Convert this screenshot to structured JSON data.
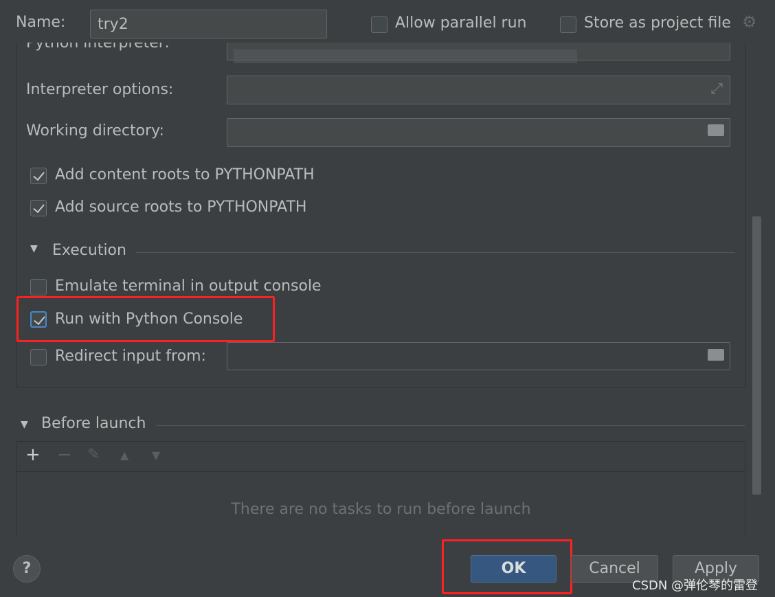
{
  "header": {
    "name_label": "Name:",
    "name_value": "try2",
    "allow_parallel_label": "Allow parallel run",
    "allow_parallel_checked": false,
    "store_label": "Store as project file",
    "store_checked": false
  },
  "config": {
    "interpreter_label": "Python interpreter:",
    "interpreter_options_label": "Interpreter options:",
    "working_dir_label": "Working directory:",
    "add_content_roots": {
      "label": "Add content roots to PYTHONPATH",
      "checked": true
    },
    "add_source_roots": {
      "label": "Add source roots to PYTHONPATH",
      "checked": true
    }
  },
  "execution": {
    "title": "Execution",
    "emulate_terminal": {
      "label": "Emulate terminal in output console",
      "checked": false
    },
    "run_with_console": {
      "label": "Run with Python Console",
      "checked": true
    },
    "redirect_input": {
      "label": "Redirect input from:",
      "checked": false,
      "value": ""
    }
  },
  "before_launch": {
    "title": "Before launch",
    "empty_text": "There are no tasks to run before launch"
  },
  "footer": {
    "help": "?",
    "ok": "OK",
    "cancel": "Cancel",
    "apply": "Apply"
  },
  "watermark": "CSDN @弹伦琴的雷登",
  "colors": {
    "highlight": "#ff2020",
    "primary_button": "#365880"
  }
}
